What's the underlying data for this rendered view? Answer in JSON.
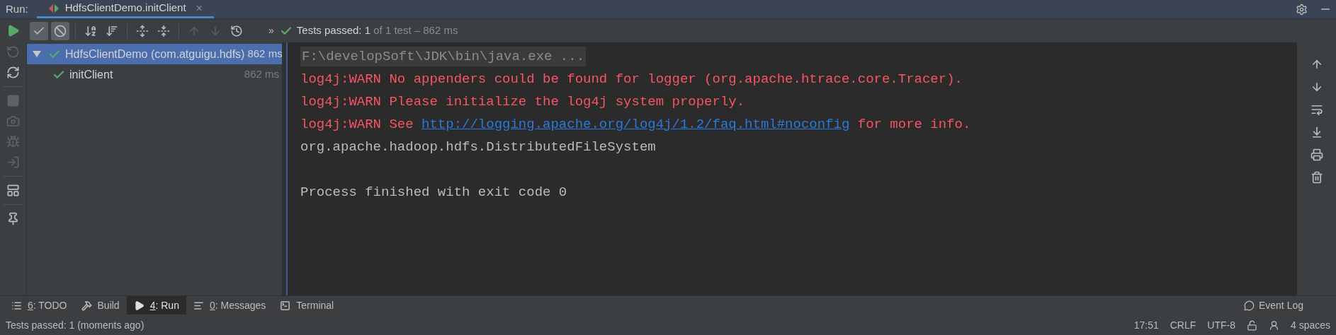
{
  "header": {
    "label": "Run:",
    "tabs": [
      {
        "title": "HdfsClientDemo.initClient",
        "close": "×",
        "selected": true
      }
    ]
  },
  "toolbar": {
    "buttons": [
      {
        "kind": "passed",
        "selected": true
      },
      {
        "kind": "ignored",
        "selected": true
      },
      {
        "kind": "sort-alpha",
        "selected": false
      },
      {
        "kind": "sort-duration",
        "selected": false
      },
      {
        "kind": "expand",
        "selected": false
      },
      {
        "kind": "collapse",
        "selected": false
      },
      {
        "kind": "prev",
        "disabled": true
      },
      {
        "kind": "next",
        "disabled": true
      },
      {
        "kind": "history",
        "disabled": false
      }
    ],
    "more": "»",
    "status": "Tests passed: 1",
    "status_rest": " of 1 test – 862 ms"
  },
  "side_toolbar": [
    {
      "kind": "run",
      "disabled": false
    },
    {
      "kind": "rerun-failed",
      "disabled": true
    },
    {
      "kind": "auto-test",
      "disabled": false
    },
    {
      "kind": "stop",
      "disabled": true
    },
    {
      "kind": "snapshot",
      "disabled": true
    },
    {
      "kind": "debug",
      "disabled": true
    },
    {
      "kind": "import",
      "disabled": true
    },
    {
      "kind": "layout",
      "disabled": false
    },
    {
      "kind": "pin",
      "disabled": false
    }
  ],
  "tree": [
    {
      "name": "HdfsClientDemo (com.atguigu.hdfs)",
      "time": "862 ms",
      "selected": true,
      "expanded": true,
      "children": [
        {
          "name": "initClient",
          "time": "862 ms",
          "selected": false
        }
      ]
    }
  ],
  "console": [
    {
      "kind": "command",
      "text": "F:\\developSoft\\JDK\\bin\\java.exe ..."
    },
    {
      "kind": "warn",
      "text": "log4j:WARN No appenders could be found for logger (org.apache.htrace.core.Tracer)."
    },
    {
      "kind": "warn",
      "text": "log4j:WARN Please initialize the log4j system properly."
    },
    {
      "kind": "warn",
      "text": "log4j:WARN See ",
      "link": "http://logging.apache.org/log4j/1.2/faq.html#noconfig",
      "after": " for more info."
    },
    {
      "kind": "out",
      "text": "org.apache.hadoop.hdfs.DistributedFileSystem"
    },
    {
      "kind": "blank"
    },
    {
      "kind": "out",
      "text": "Process finished with exit code 0"
    }
  ],
  "console_toolbar": [
    {
      "kind": "up"
    },
    {
      "kind": "down"
    },
    {
      "kind": "wrap"
    },
    {
      "kind": "scroll-end"
    },
    {
      "kind": "print"
    },
    {
      "kind": "clear"
    }
  ],
  "tool_tabs": [
    {
      "kind": "todo",
      "mnemonic": "6",
      "label": ": TODO",
      "selected": false
    },
    {
      "kind": "build",
      "label": "Build",
      "selected": false
    },
    {
      "kind": "run",
      "mnemonic": "4",
      "label": ": Run",
      "selected": true
    },
    {
      "kind": "messages",
      "mnemonic": "0",
      "label": ": Messages",
      "selected": false
    },
    {
      "kind": "terminal",
      "label": "Terminal",
      "selected": false
    }
  ],
  "event_log": "Event Log",
  "status_bar": {
    "message": "Tests passed: 1 (moments ago)",
    "position": "17:51",
    "line_separator": "CRLF",
    "encoding": "UTF-8",
    "indent": "4 spaces"
  }
}
